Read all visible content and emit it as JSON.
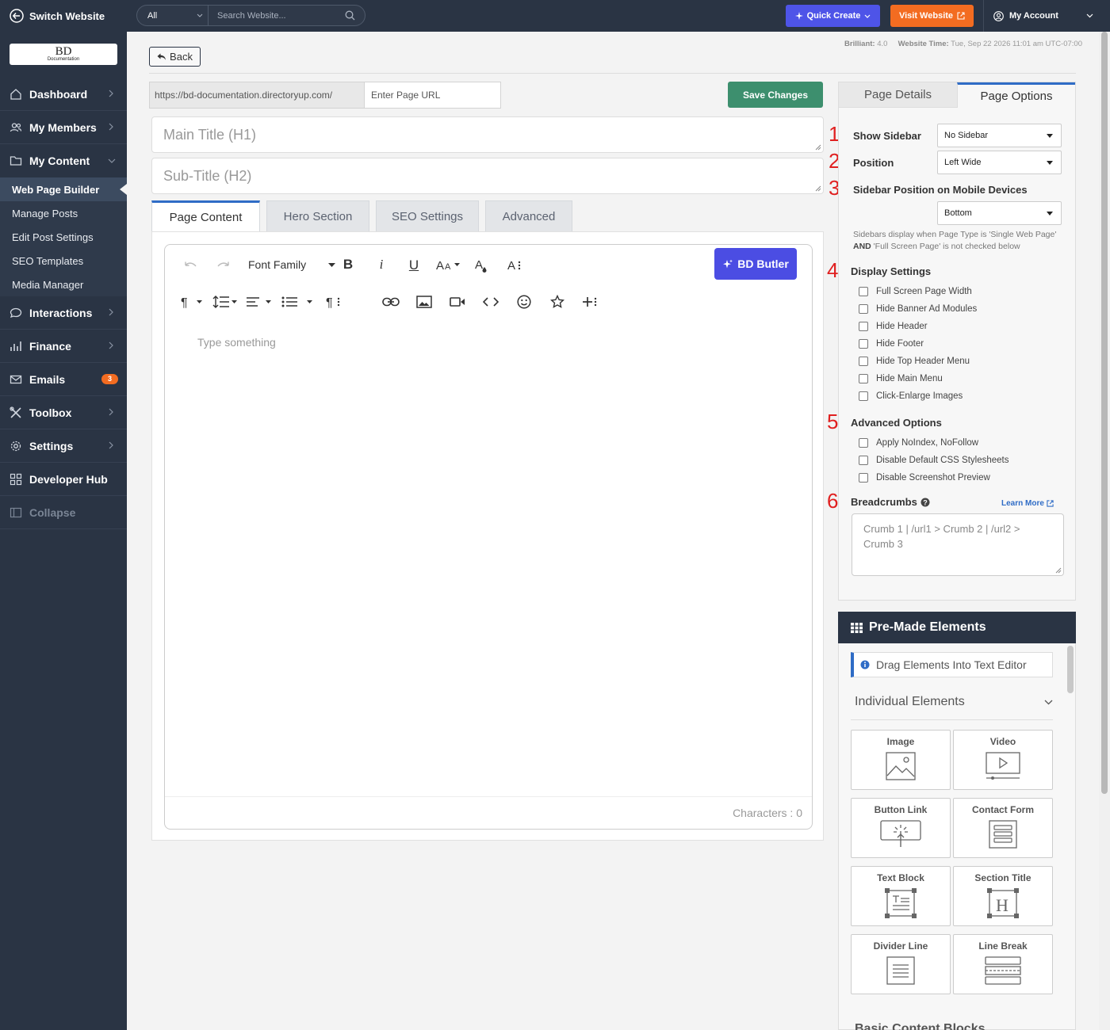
{
  "topbar": {
    "switch_label": "Switch Website",
    "search_scope": "All",
    "search_placeholder": "Search Website...",
    "quick_create": "Quick Create",
    "visit_website": "Visit Website",
    "my_account": "My Account",
    "colors": {
      "quick_create": "#4e54e8",
      "visit_website": "#f36c21",
      "bar": "#2a3444"
    }
  },
  "sidebar": {
    "logo_main": "BD",
    "logo_sub": "Documentation",
    "items": [
      {
        "label": "Dashboard",
        "icon": "home-icon"
      },
      {
        "label": "My Members",
        "icon": "members-icon"
      },
      {
        "label": "My Content",
        "icon": "folder-icon"
      },
      {
        "label": "Interactions",
        "icon": "chat-icon"
      },
      {
        "label": "Finance",
        "icon": "chart-icon"
      },
      {
        "label": "Emails",
        "icon": "mail-icon",
        "badge": "3"
      },
      {
        "label": "Toolbox",
        "icon": "tools-icon"
      },
      {
        "label": "Settings",
        "icon": "gear-icon"
      },
      {
        "label": "Developer Hub",
        "icon": "grid-icon"
      },
      {
        "label": "Collapse",
        "icon": "collapse-icon"
      }
    ],
    "content_sub": [
      "Web Page Builder",
      "Manage Posts",
      "Edit Post Settings",
      "SEO Templates",
      "Media Manager"
    ],
    "active_sub": "Web Page Builder"
  },
  "header": {
    "back": "Back",
    "meta_label1": "Brilliant:",
    "meta_value1": "4.0",
    "meta_label2": "Website Time:",
    "meta_value2": "Tue, Sep 22 2026 11:01 am UTC-07:00"
  },
  "form": {
    "url_prefix": "https://bd-documentation.directoryup.com/",
    "url_placeholder": "Enter Page URL",
    "save": "Save Changes",
    "main_title_placeholder": "Main Title (H1)",
    "sub_title_placeholder": "Sub-Title (H2)"
  },
  "tabs": [
    "Page Content",
    "Hero Section",
    "SEO Settings",
    "Advanced"
  ],
  "editor": {
    "font_family": "Font Family",
    "butler": "BD Butler",
    "placeholder": "Type something",
    "characters": "Characters : 0"
  },
  "options": {
    "tabs": [
      "Page Details",
      "Page Options"
    ],
    "markers": [
      "1",
      "2",
      "3",
      "4",
      "5",
      "6"
    ],
    "show_sidebar_label": "Show Sidebar",
    "show_sidebar_value": "No Sidebar",
    "position_label": "Position",
    "position_value": "Left Wide",
    "mobile_label": "Sidebar Position on Mobile Devices",
    "mobile_value": "Bottom",
    "note_part1": "Sidebars display when Page Type is 'Single Web Page'",
    "note_and": "AND",
    "note_part2": "'Full Screen Page' is not checked below",
    "display_title": "Display Settings",
    "display": [
      "Full Screen Page Width",
      "Hide Banner Ad Modules",
      "Hide Header",
      "Hide Footer",
      "Hide Top Header Menu",
      "Hide Main Menu",
      "Click-Enlarge Images"
    ],
    "advanced_title": "Advanced Options",
    "advanced": [
      "Apply NoIndex, NoFollow",
      "Disable Default CSS Stylesheets",
      "Disable Screenshot Preview"
    ],
    "breadcrumbs_title": "Breadcrumbs",
    "learn_more": "Learn More",
    "breadcrumbs_placeholder": "Crumb 1 | /url1 > Crumb 2 | /url2 > Crumb 3"
  },
  "premade": {
    "title": "Pre-Made Elements",
    "drag_hint": "Drag Elements Into Text Editor",
    "section": "Individual Elements",
    "elements": [
      "Image",
      "Video",
      "Button Link",
      "Contact Form",
      "Text Block",
      "Section Title",
      "Divider Line",
      "Line Break"
    ],
    "next_section": "Basic Content Blocks"
  }
}
